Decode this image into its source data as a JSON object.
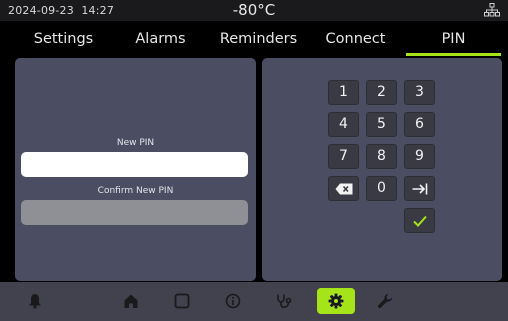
{
  "status": {
    "date": "2024-09-23",
    "time": "14:27",
    "temperature": "-80°C"
  },
  "tabs": [
    {
      "label": "Settings"
    },
    {
      "label": "Alarms"
    },
    {
      "label": "Reminders"
    },
    {
      "label": "Connect"
    },
    {
      "label": "PIN",
      "active": true
    }
  ],
  "pin_form": {
    "new_pin_label": "New PIN",
    "new_pin_value": "",
    "confirm_pin_label": "Confirm New PIN",
    "confirm_pin_value": ""
  },
  "keypad": {
    "keys": [
      "1",
      "2",
      "3",
      "4",
      "5",
      "6",
      "7",
      "8",
      "9",
      "backspace",
      "0",
      "tab",
      "confirm"
    ],
    "k1": "1",
    "k2": "2",
    "k3": "3",
    "k4": "4",
    "k5": "5",
    "k6": "6",
    "k7": "7",
    "k8": "8",
    "k9": "9",
    "k0": "0"
  },
  "bottom_nav": {
    "icons": [
      "bell-icon",
      "home-icon",
      "square-icon",
      "info-icon",
      "stethoscope-icon",
      "gear-icon",
      "wrench-icon"
    ],
    "active": "gear-icon"
  },
  "colors": {
    "accent": "#a6e41a",
    "panel": "#4b4d63",
    "bottom_bar": "#41424d",
    "key": "#3a3a44"
  }
}
